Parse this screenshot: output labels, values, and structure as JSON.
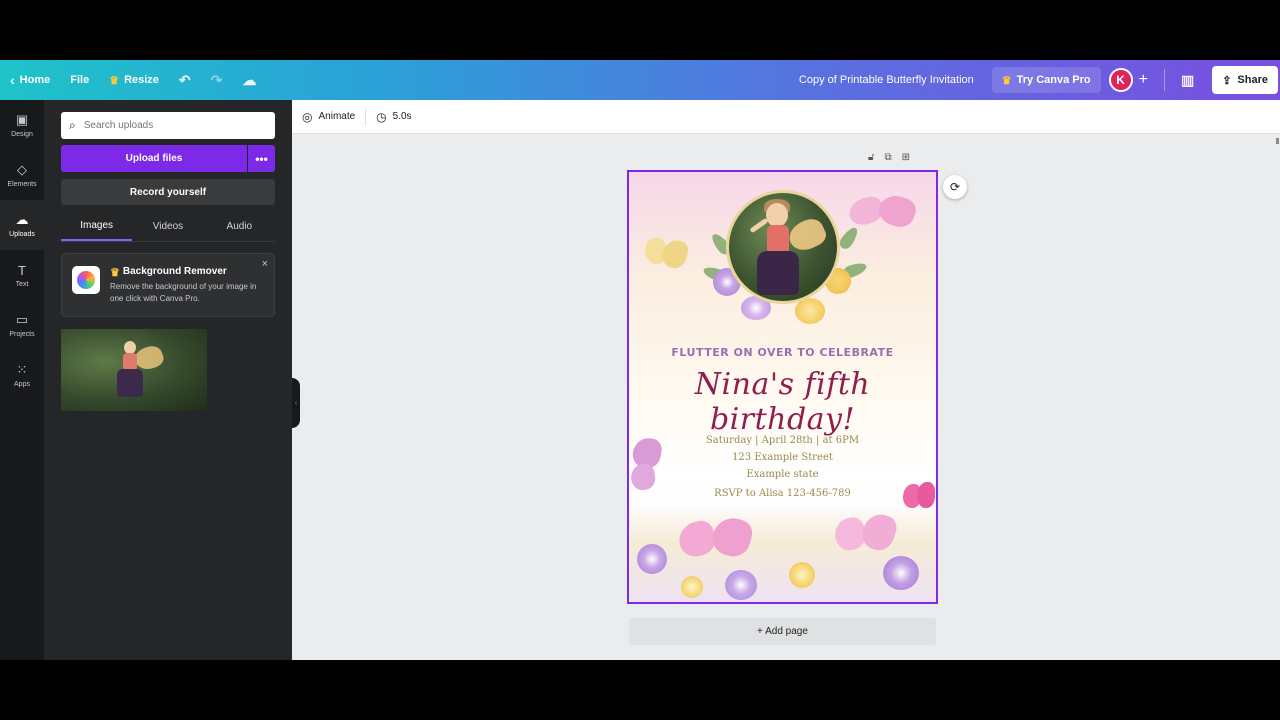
{
  "topbar": {
    "home": "Home",
    "file": "File",
    "resize": "Resize",
    "doc_title": "Copy of Printable Butterfly Invitation",
    "try_pro": "Try Canva Pro",
    "avatar_initial": "K",
    "share": "Share"
  },
  "rail": {
    "items": [
      {
        "label": "Design",
        "icon": "design-icon"
      },
      {
        "label": "Elements",
        "icon": "elements-icon"
      },
      {
        "label": "Uploads",
        "icon": "upload-cloud-icon"
      },
      {
        "label": "Text",
        "icon": "text-icon"
      },
      {
        "label": "Projects",
        "icon": "folder-icon"
      },
      {
        "label": "Apps",
        "icon": "apps-grid-icon"
      }
    ]
  },
  "panel": {
    "search_placeholder": "Search uploads",
    "upload_files": "Upload files",
    "record_yourself": "Record yourself",
    "tabs": [
      "Images",
      "Videos",
      "Audio"
    ],
    "promo": {
      "title": "Background Remover",
      "text": "Remove the background of your image in one click with Canva Pro."
    }
  },
  "canvas_toolbar": {
    "animate": "Animate",
    "duration": "5.0s"
  },
  "design": {
    "tagline": "FLUTTER ON OVER TO CELEBRATE",
    "headline": "Nina's fifth birthday!",
    "date_line": "Saturday | April 28th | at 6PM",
    "street": "123 Example Street",
    "state": "Example state",
    "rsvp": "RSVP to Alisa 123-456-789"
  },
  "add_page": "+ Add page",
  "colors": {
    "accent": "#7d2ae8",
    "headline": "#8e1f4f",
    "tagline": "#9a6fb0",
    "details": "#9a8a4a"
  }
}
